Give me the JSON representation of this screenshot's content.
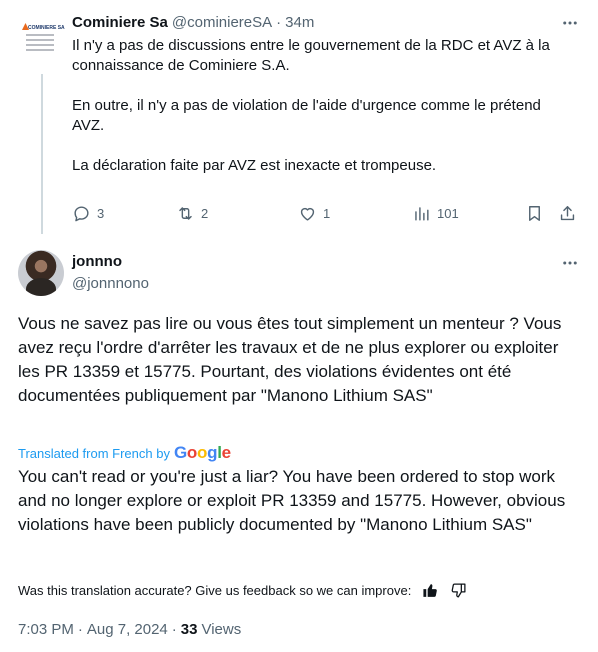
{
  "parent_tweet": {
    "avatar_logo_text": "COMINIERE SA",
    "author_name": "Cominiere Sa",
    "author_handle": "@cominiereSA",
    "separator": "·",
    "time_ago": "34m",
    "paragraphs": [
      "Il n'y a pas de discussions entre le gouvernement de la RDC et AVZ à la connaissance de Cominiere S.A.",
      "En outre, il n'y a pas de violation de l'aide d'urgence comme le prétend AVZ.",
      "La déclaration faite par AVZ est inexacte et trompeuse."
    ],
    "actions": {
      "replies": "3",
      "reposts": "2",
      "likes": "1",
      "views": "101"
    }
  },
  "main_tweet": {
    "author_name": "jonnno",
    "author_handle": "@jonnnono",
    "text": "Vous ne savez pas lire ou vous êtes tout simplement un menteur ? Vous avez reçu l'ordre d'arrêter les travaux et de ne plus explorer ou exploiter les PR 13359 et 15775. Pourtant, des violations évidentes ont été documentées publiquement par \"Manono Lithium SAS\"",
    "translated_label": "Translated from French by",
    "translation_provider": "Google",
    "translation": "You can't read or you're just a liar? You have been ordered to stop work and no longer explore or exploit PR 13359 and 15775. However, obvious violations have been publicly documented by \"Manono Lithium SAS\"",
    "feedback_prompt": "Was this translation accurate? Give us feedback so we can improve:",
    "time": "7:03 PM",
    "separator": "·",
    "date": "Aug 7, 2024",
    "views_count": "33",
    "views_label": "Views"
  },
  "colors": {
    "text_primary": "#0f1419",
    "text_secondary": "#536471",
    "accent_blue": "#1d9bf0",
    "thread_line": "#cfd9de"
  }
}
